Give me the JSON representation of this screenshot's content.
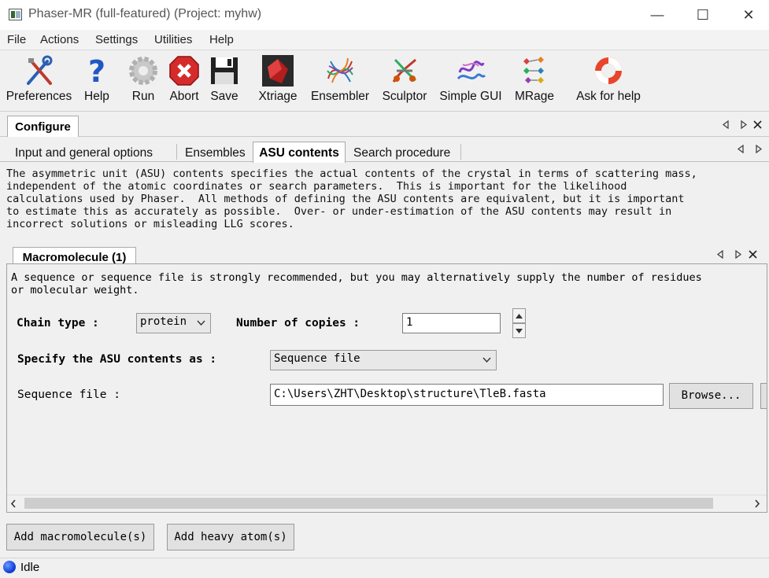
{
  "window": {
    "title": "Phaser-MR (full-featured) (Project: myhw)",
    "controls": {
      "minimize": "—",
      "maximize": "☐",
      "close": "✕"
    }
  },
  "menu": [
    "File",
    "Actions",
    "Settings",
    "Utilities",
    "Help"
  ],
  "toolbar": [
    {
      "label": "Preferences",
      "icon": "preferences-icon"
    },
    {
      "label": "Help",
      "icon": "help-icon"
    },
    {
      "label": "Run",
      "icon": "run-icon"
    },
    {
      "label": "Abort",
      "icon": "abort-icon"
    },
    {
      "label": "Save",
      "icon": "save-icon"
    },
    {
      "label": "Xtriage",
      "icon": "xtriage-icon"
    },
    {
      "label": "Ensembler",
      "icon": "ensembler-icon"
    },
    {
      "label": "Sculptor",
      "icon": "sculptor-icon"
    },
    {
      "label": "Simple GUI",
      "icon": "simple-gui-icon"
    },
    {
      "label": "MRage",
      "icon": "mrage-icon"
    },
    {
      "label": "Ask for help",
      "icon": "ask-for-help-icon"
    }
  ],
  "outer_tab": {
    "label": "Configure"
  },
  "sub_tabs": [
    "Input and general options",
    "Ensembles",
    "ASU contents",
    "Search procedure"
  ],
  "active_sub_tab": "ASU contents",
  "description": "The asymmetric unit (ASU) contents specifies the actual contents of the crystal in terms of scattering mass,\nindependent of the atomic coordinates or search parameters.  This is important for the likelihood\ncalculations used by Phaser.  All methods of defining the ASU contents are equivalent, but it is important\nto estimate this as accurately as possible.  Over- or under-estimation of the ASU contents may result in\nincorrect solutions or misleading LLG scores.",
  "macro_tab": {
    "label": "Macromolecule (1)"
  },
  "macro": {
    "hint": "A sequence or sequence file is strongly recommended, but you may alternatively supply the number of residues\nor molecular weight.",
    "chain_type_label": "Chain type :",
    "chain_type_value": "protein",
    "copies_label": "Number of copies :",
    "copies_value": "1",
    "asu_as_label": "Specify the ASU contents as :",
    "asu_as_value": "Sequence file",
    "seq_file_label": "Sequence file :",
    "seq_file_value": "C:\\Users\\ZHT\\Desktop\\structure\\TleB.fasta",
    "browse_label": "Browse..."
  },
  "buttons": {
    "add_macromolecule": "Add macromolecule(s)",
    "add_heavy_atom": "Add heavy atom(s)"
  },
  "status": {
    "text": "Idle",
    "color": "#1144dd"
  }
}
